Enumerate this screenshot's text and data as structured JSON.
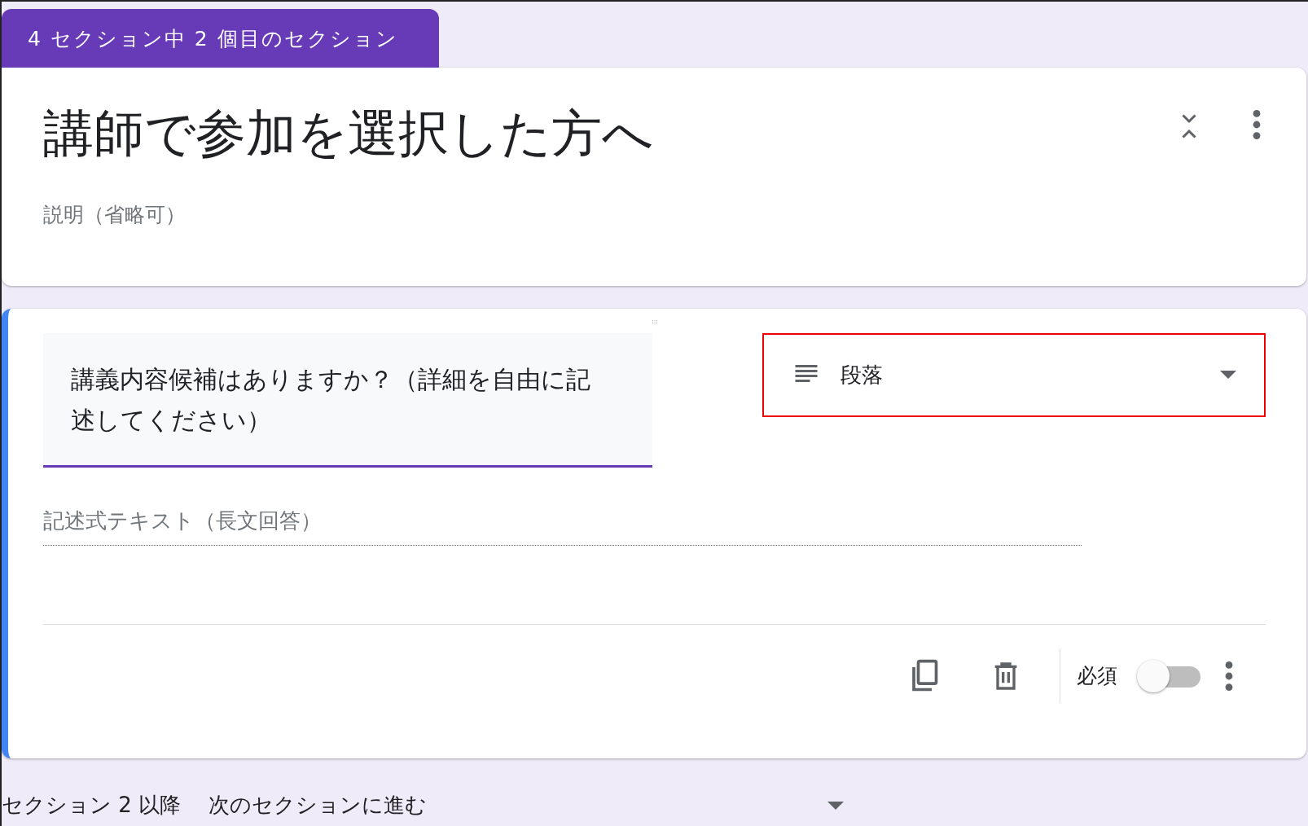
{
  "section_badge": "4 セクション中 2 個目のセクション",
  "section_header": {
    "title": "講師で参加を選択した方へ",
    "description_placeholder": "説明（省略可）"
  },
  "question": {
    "title": "講義内容候補はありますか？（詳細を自由に記述してください）",
    "type": {
      "label": "段落",
      "highlighted": true
    },
    "answer_placeholder": "記述式テキスト（長文回答）",
    "required": {
      "label": "必須",
      "on": false
    }
  },
  "after_section": {
    "label": "セクション 2 以降",
    "action": "次のセクションに進む"
  }
}
